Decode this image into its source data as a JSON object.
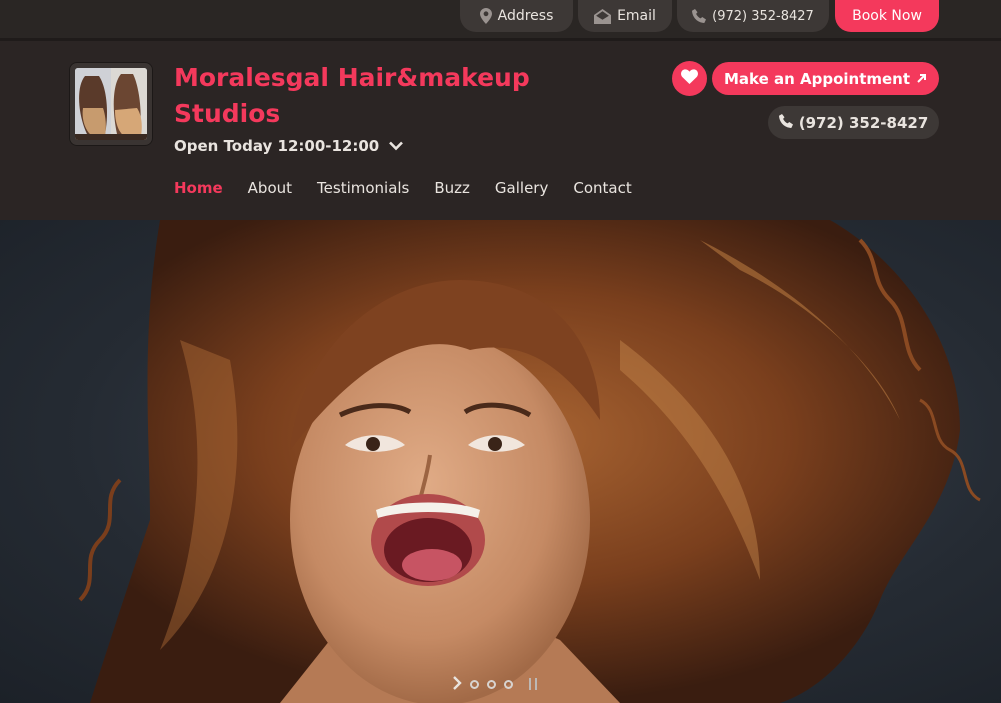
{
  "topbar": {
    "address_label": "Address",
    "email_label": "Email",
    "phone_label": "(972) 352-8427",
    "book_label": "Book Now"
  },
  "brand": {
    "name": "Moralesgal Hair&makeup Studios",
    "hours": "Open Today 12:00-12:00"
  },
  "nav": {
    "items": [
      {
        "label": "Home",
        "active": true
      },
      {
        "label": "About"
      },
      {
        "label": "Testimonials"
      },
      {
        "label": "Buzz"
      },
      {
        "label": "Gallery"
      },
      {
        "label": "Contact"
      }
    ]
  },
  "actions": {
    "appointment_label": "Make an Appointment",
    "phone_label": "(972) 352-8427"
  },
  "slider": {
    "slides_count": 3,
    "active_index": 0
  },
  "colors": {
    "accent": "#f4395c",
    "header_bg": "#2b2524",
    "pill_bg": "#3d3836",
    "text_light": "#e9e4df"
  },
  "icons": {
    "address": "location-pin-icon",
    "email": "envelope-icon",
    "phone": "phone-icon",
    "favorite": "heart-icon",
    "external": "arrow-up-right-icon",
    "hours_toggle": "chevron-down-icon",
    "slider_next": "chevron-right-icon",
    "slider_pause": "pause-icon"
  }
}
